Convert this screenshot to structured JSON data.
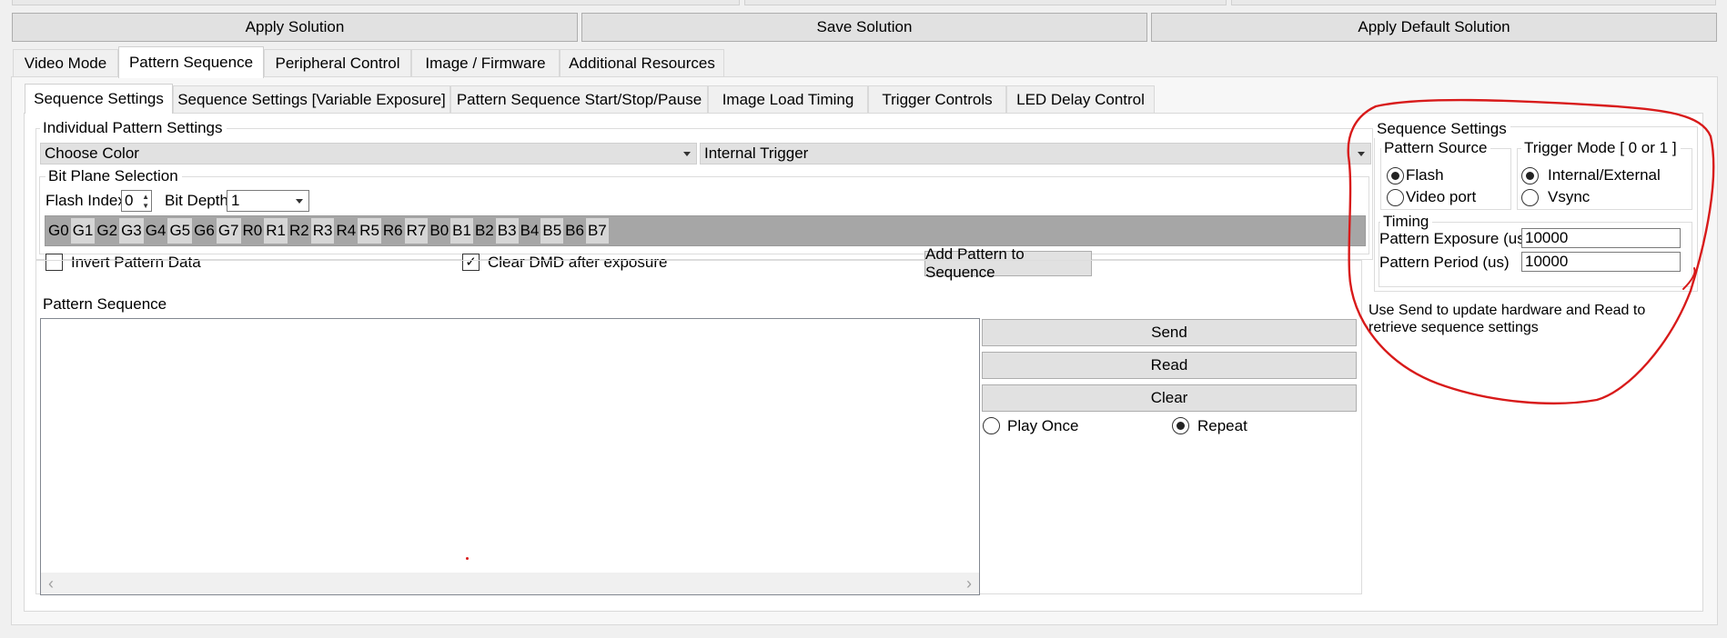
{
  "toolbar": {
    "apply_solution": "Apply Solution",
    "save_solution": "Save Solution",
    "apply_default_solution": "Apply Default Solution"
  },
  "main_tabs": [
    {
      "label": "Video Mode",
      "active": false
    },
    {
      "label": "Pattern Sequence",
      "active": true
    },
    {
      "label": "Peripheral Control",
      "active": false
    },
    {
      "label": "Image / Firmware",
      "active": false
    },
    {
      "label": "Additional Resources",
      "active": false
    }
  ],
  "sub_tabs": [
    {
      "label": "Sequence Settings",
      "active": true
    },
    {
      "label": "Sequence Settings [Variable Exposure]",
      "active": false
    },
    {
      "label": "Pattern Sequence Start/Stop/Pause",
      "active": false
    },
    {
      "label": "Image Load Timing",
      "active": false
    },
    {
      "label": "Trigger Controls",
      "active": false
    },
    {
      "label": "LED Delay Control",
      "active": false
    }
  ],
  "individual": {
    "group_label": "Individual Pattern Settings",
    "color_select": "Choose Color",
    "trigger_select": "Internal Trigger",
    "bitplane_label": "Bit Plane Selection",
    "flash_index_label": "Flash Index",
    "flash_index_value": "0",
    "bit_depth_label": "Bit Depth",
    "bit_depth_value": "1",
    "bit_planes": [
      "G0",
      "G1",
      "G2",
      "G3",
      "G4",
      "G5",
      "G6",
      "G7",
      "R0",
      "R1",
      "R2",
      "R3",
      "R4",
      "R5",
      "R6",
      "R7",
      "B0",
      "B1",
      "B2",
      "B3",
      "B4",
      "B5",
      "B6",
      "B7"
    ],
    "invert_label": "Invert Pattern Data",
    "invert_checked": false,
    "clear_dmd_label": "Clear DMD after exposure",
    "clear_dmd_checked": true,
    "add_pattern_button": "Add Pattern to Sequence"
  },
  "pattern_sequence": {
    "group_label": "Pattern Sequence",
    "send_button": "Send",
    "read_button": "Read",
    "clear_button": "Clear",
    "play_once_label": "Play Once",
    "repeat_label": "Repeat",
    "repeat_selected": true
  },
  "sequence_settings": {
    "group_label": "Sequence Settings",
    "pattern_source_label": "Pattern Source",
    "source_flash": "Flash",
    "source_video": "Video port",
    "trigger_mode_label": "Trigger Mode [ 0 or 1 ]",
    "trigger_internal": "Internal/External",
    "trigger_vsync": "Vsync",
    "timing_label": "Timing",
    "exposure_label": "Pattern Exposure (us)",
    "exposure_value": "10000",
    "period_label": "Pattern Period (us)",
    "period_value": "10000",
    "help_line1": "Use Send to update hardware and Read to",
    "help_line2": "retrieve sequence settings"
  },
  "colors": {
    "annotation": "#d81a1a",
    "bitplane_dark": "#a6a6a6",
    "bitplane_light": "#d6d6d6"
  }
}
